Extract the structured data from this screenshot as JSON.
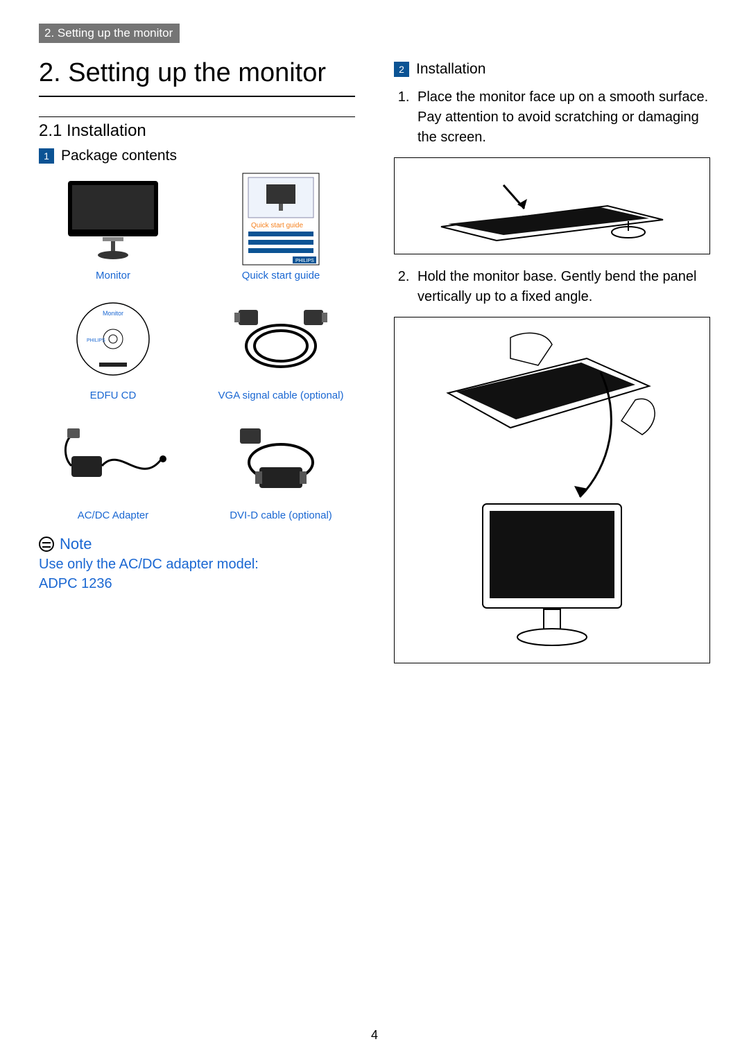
{
  "header_tab": "2. Setting up the monitor",
  "main_heading": "2.  Setting up the monitor",
  "section_heading": "2.1  Installation",
  "sub1": {
    "num": "1",
    "label": "Package contents"
  },
  "packages": {
    "monitor": "Monitor",
    "qsg": "Quick start guide",
    "qsg_inner": "Quick start guide",
    "brand": "PHILIPS",
    "cd": "EDFU CD",
    "cd_label": "Monitor",
    "vga": "VGA signal cable (optional)",
    "adapter": "AC/DC Adapter",
    "dvi": "DVI-D cable (optional)"
  },
  "note": {
    "title": "Note",
    "body": "Use only the AC/DC adapter model:",
    "model": "ADPC 1236"
  },
  "sub2": {
    "num": "2",
    "label": "Installation"
  },
  "steps": [
    "Place the monitor face up on a smooth surface. Pay attention to avoid scratching or damaging the screen.",
    "Hold the monitor base. Gently bend the panel vertically up to a fixed angle."
  ],
  "page_number": "4"
}
